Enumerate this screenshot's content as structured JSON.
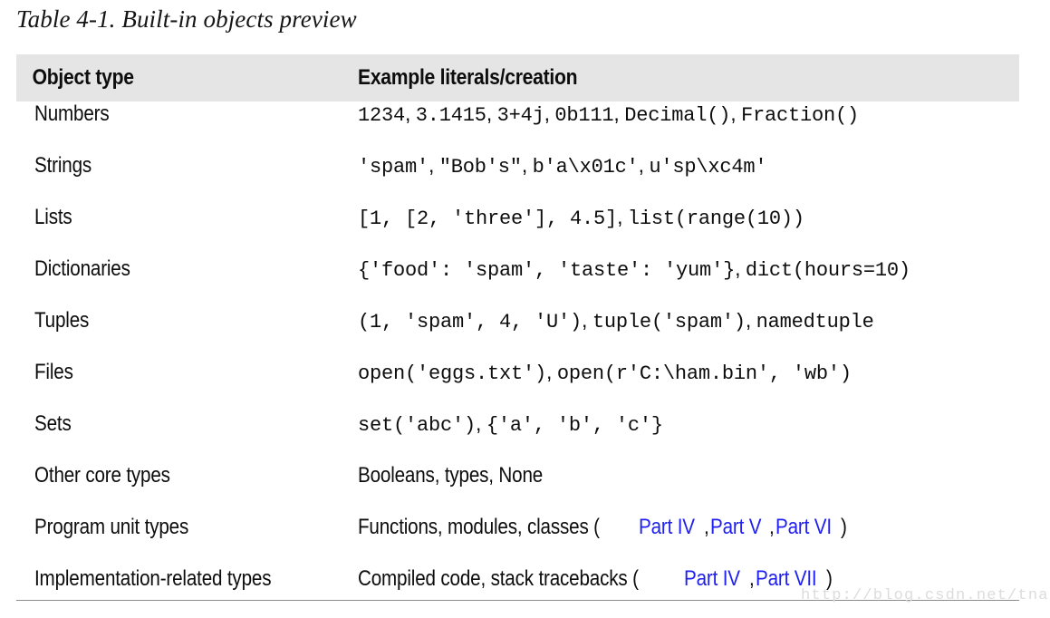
{
  "caption": "Table 4-1. Built-in objects preview",
  "table": {
    "columns": [
      "Object type",
      "Example literals/creation"
    ],
    "rows": [
      {
        "type": "Numbers",
        "example_plain": "1234, 3.1415, 3+4j, 0b111, Decimal(), Fraction()",
        "parts": [
          {
            "text": "1234",
            "style": "mono"
          },
          {
            "text": ", ",
            "style": "sep"
          },
          {
            "text": "3.1415",
            "style": "mono"
          },
          {
            "text": ", ",
            "style": "sep"
          },
          {
            "text": "3+4j",
            "style": "mono"
          },
          {
            "text": ", ",
            "style": "sep"
          },
          {
            "text": "0b111",
            "style": "mono"
          },
          {
            "text": ", ",
            "style": "sep"
          },
          {
            "text": "Decimal()",
            "style": "mono"
          },
          {
            "text": ", ",
            "style": "sep"
          },
          {
            "text": "Fraction()",
            "style": "mono"
          }
        ]
      },
      {
        "type": "Strings",
        "example_plain": "'spam', \"Bob's\", b'a\\x01c', u'sp\\xc4m'",
        "parts": [
          {
            "text": "'spam'",
            "style": "mono"
          },
          {
            "text": ", ",
            "style": "sep"
          },
          {
            "text": "\"Bob's\"",
            "style": "mono"
          },
          {
            "text": ", ",
            "style": "sep"
          },
          {
            "text": "b'a\\x01c'",
            "style": "mono"
          },
          {
            "text": ", ",
            "style": "sep"
          },
          {
            "text": "u'sp\\xc4m'",
            "style": "mono"
          }
        ]
      },
      {
        "type": "Lists",
        "example_plain": "[1, [2, 'three'], 4.5], list(range(10))",
        "parts": [
          {
            "text": "[1, [2, 'three'], 4.5]",
            "style": "mono"
          },
          {
            "text": ", ",
            "style": "sep"
          },
          {
            "text": "list(range(10))",
            "style": "mono"
          }
        ]
      },
      {
        "type": "Dictionaries",
        "example_plain": "{'food': 'spam', 'taste': 'yum'}, dict(hours=10)",
        "parts": [
          {
            "text": "{'food': 'spam', 'taste': 'yum'}",
            "style": "mono"
          },
          {
            "text": ", ",
            "style": "sep"
          },
          {
            "text": "dict(hours=10)",
            "style": "mono"
          }
        ]
      },
      {
        "type": "Tuples",
        "example_plain": "(1, 'spam', 4, 'U'), tuple('spam'), namedtuple",
        "parts": [
          {
            "text": "(1, 'spam', 4, 'U')",
            "style": "mono"
          },
          {
            "text": ", ",
            "style": "sep"
          },
          {
            "text": "tuple('spam')",
            "style": "mono"
          },
          {
            "text": ", ",
            "style": "sep"
          },
          {
            "text": "namedtuple",
            "style": "mono"
          }
        ]
      },
      {
        "type": "Files",
        "example_plain": "open('eggs.txt'), open(r'C:\\ham.bin', 'wb')",
        "parts": [
          {
            "text": "open('eggs.txt')",
            "style": "mono"
          },
          {
            "text": ", ",
            "style": "sep"
          },
          {
            "text": "open(r'C:\\ham.bin', 'wb')",
            "style": "mono"
          }
        ]
      },
      {
        "type": "Sets",
        "example_plain": "set('abc'), {'a', 'b', 'c'}",
        "parts": [
          {
            "text": "set('abc')",
            "style": "mono"
          },
          {
            "text": ", ",
            "style": "sep"
          },
          {
            "text": "{'a', 'b', 'c'}",
            "style": "mono"
          }
        ]
      },
      {
        "type": "Other core types",
        "example_plain": "Booleans, types, None",
        "parts": [
          {
            "text": "Booleans, types, None",
            "style": "prose"
          }
        ]
      },
      {
        "type": "Program unit types",
        "example_plain": "Functions, modules, classes (Part IV, Part V, Part VI)",
        "parts": [
          {
            "text": "Functions, modules, classes (",
            "style": "prose"
          },
          {
            "text": "Part IV",
            "style": "prose link"
          },
          {
            "text": ", ",
            "style": "prose"
          },
          {
            "text": "Part V",
            "style": "prose link"
          },
          {
            "text": ", ",
            "style": "prose"
          },
          {
            "text": "Part VI",
            "style": "prose link"
          },
          {
            "text": ")",
            "style": "prose"
          }
        ]
      },
      {
        "type": "Implementation-related types",
        "example_plain": "Compiled code, stack tracebacks (Part IV, Part VII)",
        "parts": [
          {
            "text": "Compiled code, stack tracebacks (",
            "style": "prose"
          },
          {
            "text": "Part IV",
            "style": "prose link"
          },
          {
            "text": ", ",
            "style": "prose"
          },
          {
            "text": "Part VII",
            "style": "prose link"
          },
          {
            "text": ")",
            "style": "prose"
          }
        ]
      }
    ]
  },
  "watermark": "http://blog.csdn.net/tnaig",
  "colors": {
    "header_band": "#e5e5e5",
    "link": "#2020f0",
    "text": "#0d0d0d",
    "rule": "#8c8c8c",
    "watermark": "#dcdcdc"
  }
}
